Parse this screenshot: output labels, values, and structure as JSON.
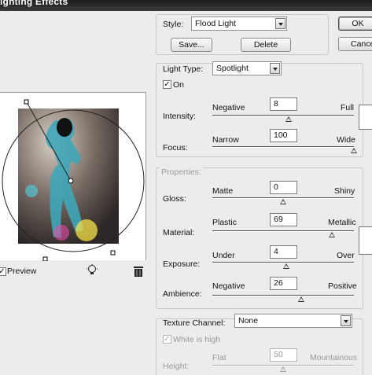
{
  "title": "ighting Effects",
  "style": {
    "label": "Style:",
    "value": "Flood Light",
    "save": "Save...",
    "delete": "Delete"
  },
  "buttons": {
    "ok": "OK",
    "cancel": "Cance"
  },
  "light": {
    "type_label": "Light Type:",
    "type_value": "Spotlight",
    "on_label": "On",
    "on_checked": true,
    "intensity": {
      "label": "Intensity:",
      "min": "Negative",
      "max": "Full",
      "value": "8",
      "fraction": 0.54
    },
    "focus": {
      "label": "Focus:",
      "min": "Narrow",
      "max": "Wide",
      "value": "100",
      "fraction": 1.0
    }
  },
  "properties": {
    "header": "Properties:",
    "gloss": {
      "label": "Gloss:",
      "min": "Matte",
      "max": "Shiny",
      "value": "0",
      "fraction": 0.5
    },
    "material": {
      "label": "Material:",
      "min": "Plastic",
      "max": "Metallic",
      "value": "69",
      "fraction": 0.845
    },
    "exposure": {
      "label": "Exposure:",
      "min": "Under",
      "max": "Over",
      "value": "4",
      "fraction": 0.52
    },
    "ambience": {
      "label": "Ambience:",
      "min": "Negative",
      "max": "Positive",
      "value": "26",
      "fraction": 0.63
    }
  },
  "texture": {
    "label": "Texture Channel:",
    "value": "None",
    "white_label": "White is high",
    "height": {
      "label": "Height:",
      "min": "Flat",
      "max": "Mountainous",
      "value": "50",
      "fraction": 0.5
    }
  },
  "preview": {
    "label": "Preview",
    "checked": true,
    "light_icon": "lightbulb-icon",
    "trash_icon": "trash-icon"
  }
}
